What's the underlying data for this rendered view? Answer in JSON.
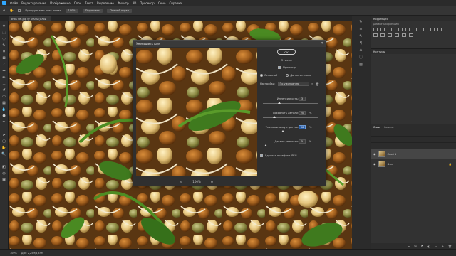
{
  "menu": [
    "Файл",
    "Редактирование",
    "Изображение",
    "Слои",
    "Текст",
    "Выделение",
    "Фильтр",
    "3D",
    "Просмотр",
    "Окно",
    "Справка"
  ],
  "options": {
    "scroll_all": "Прокрутка во всех окнах",
    "zoom": "100%",
    "fit_screen": "Подогнать",
    "full_screen": "Полный экран"
  },
  "document_tab": "bnbs 4el.jpg @ 100% (Слой 1, RGB/8)",
  "panels": {
    "correction_title": "Коррекция",
    "correction_sub": "Добавить коррекцию",
    "contours_title": "Контуры",
    "layers_tabs": [
      "Слои",
      "Каналы"
    ],
    "layers": [
      {
        "name": "Слой 1",
        "selected": true
      },
      {
        "name": "Фон",
        "selected": false
      }
    ]
  },
  "status": {
    "zoom": "100%",
    "doc_info": "Док: 2,25M/4,49M"
  },
  "dialog": {
    "title": "Уменьшить шум",
    "ok": "OK",
    "cancel": "Отмена",
    "preview_label": "Просмотр",
    "preview_checked": true,
    "mode_basic": "Основной",
    "mode_advanced": "Дополнительно",
    "settings_label": "Настройки:",
    "settings_value": "По умолчанию",
    "params": [
      {
        "label": "Интенсивность:",
        "value": "3",
        "unit": "",
        "level": 0.3
      },
      {
        "label": "Сохранить детали:",
        "value": "20",
        "unit": "%",
        "level": 0.2
      },
      {
        "label": "Уменьшить шум цветов:",
        "value": "36",
        "unit": "%",
        "level": 0.36
      },
      {
        "label": "Детали резкости:",
        "value": "5",
        "unit": "%",
        "level": 0.05
      }
    ],
    "artifact_label": "Удалить артефакт JPEG",
    "artifact_checked": true,
    "zoom": "100%"
  },
  "colors": {
    "accent": "#31a8ff",
    "focus_field": "#2b5fa8"
  }
}
